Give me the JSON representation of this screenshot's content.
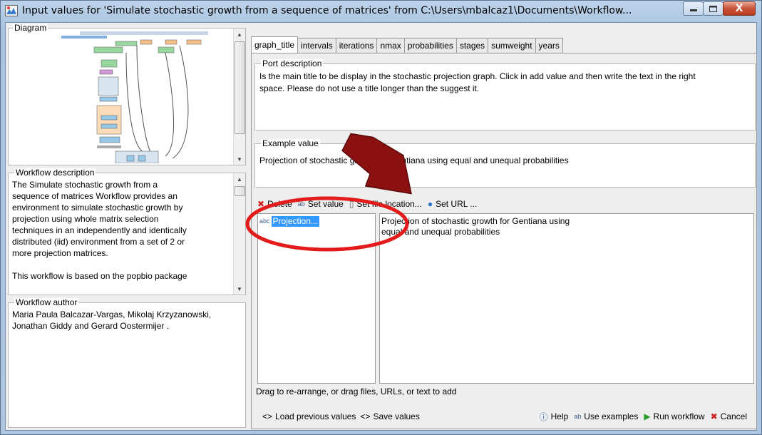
{
  "window": {
    "title": "Input values for 'Simulate stochastic growth from a sequence of matrices' from C:\\Users\\mbalcaz1\\Documents\\Workflow...",
    "minimize_icon": "minimize-icon",
    "maximize_icon": "maximize-icon",
    "close_icon": "close-icon",
    "close_glyph": "X"
  },
  "left": {
    "diagram_label": "Diagram",
    "workflow_description_label": "Workflow description",
    "workflow_description": [
      "The Simulate stochastic growth from a",
      "sequence of matrices Workflow provides an",
      "environment to simulate stochastic growth by",
      "projection using whole matrix selection",
      "techniques in an independently and identically",
      "distributed (iid) environment from a set of 2 or",
      "more projection matrices.",
      "",
      "This workflow is based on the popbio package"
    ],
    "workflow_author_label": "Workflow author",
    "workflow_author": [
      "Maria Paula Balcazar-Vargas, Mikolaj Krzyzanowski,",
      "Jonathan Giddy and Gerard Oostermijer ."
    ]
  },
  "tabs": [
    {
      "label": "graph_title",
      "active": true
    },
    {
      "label": "intervals",
      "active": false
    },
    {
      "label": "iterations",
      "active": false
    },
    {
      "label": "nmax",
      "active": false
    },
    {
      "label": "probabilities",
      "active": false
    },
    {
      "label": "stages",
      "active": false
    },
    {
      "label": "sumweight",
      "active": false
    },
    {
      "label": "years",
      "active": false
    }
  ],
  "port_description": {
    "label": "Port description",
    "line1": "Is the main title to be display in the stochastic projection graph. Click in add value and then write the text in the right",
    "line2": "space. Please do not use a title longer than the suggest it."
  },
  "example_value": {
    "label": "Example value",
    "text": "Projection of stochastic growth for Gentiana using equal and unequal probabilities"
  },
  "toolbar": {
    "delete_label": "Delete",
    "set_value_label": "Set value",
    "set_file_location_label": "Set file location...",
    "set_url_label": "Set URL ..."
  },
  "values_list": {
    "items": [
      "Projection..."
    ]
  },
  "editor": {
    "line1": "Projection of stochastic growth for Gentiana using",
    "line2": "equal and unequal probabilities"
  },
  "drag_hint": "Drag to re-arrange, or drag files, URLs, or text to add",
  "bottom": {
    "load_previous_label": "Load previous values",
    "save_values_label": "Save values",
    "help_label": "Help",
    "use_examples_label": "Use examples",
    "run_workflow_label": "Run workflow",
    "cancel_label": "Cancel"
  },
  "colors": {
    "selection": "#3399ff",
    "annotation_red": "#e31b1b",
    "arrow_fill": "#8b1010"
  }
}
